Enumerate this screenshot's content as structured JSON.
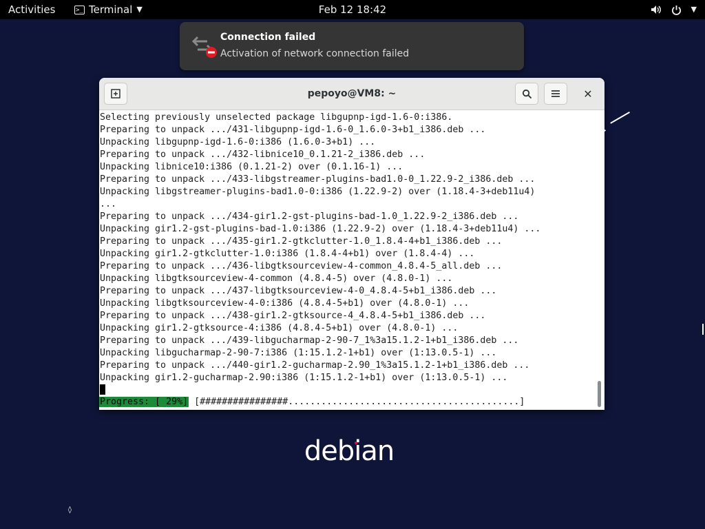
{
  "topbar": {
    "activities": "Activities",
    "app_name": "Terminal",
    "clock": "Feb 12  18:42"
  },
  "notification": {
    "title": "Connection failed",
    "body": "Activation of network connection failed"
  },
  "window": {
    "title": "pepoyo@VM8: ~"
  },
  "terminal": {
    "lines": [
      "Selecting previously unselected package libgupnp-igd-1.6-0:i386.",
      "Preparing to unpack .../431-libgupnp-igd-1.6-0_1.6.0-3+b1_i386.deb ...",
      "Unpacking libgupnp-igd-1.6-0:i386 (1.6.0-3+b1) ...",
      "Preparing to unpack .../432-libnice10_0.1.21-2_i386.deb ...",
      "Unpacking libnice10:i386 (0.1.21-2) over (0.1.16-1) ...",
      "Preparing to unpack .../433-libgstreamer-plugins-bad1.0-0_1.22.9-2_i386.deb ...",
      "Unpacking libgstreamer-plugins-bad1.0-0:i386 (1.22.9-2) over (1.18.4-3+deb11u4)",
      "...",
      "Preparing to unpack .../434-gir1.2-gst-plugins-bad-1.0_1.22.9-2_i386.deb ...",
      "Unpacking gir1.2-gst-plugins-bad-1.0:i386 (1.22.9-2) over (1.18.4-3+deb11u4) ...",
      "Preparing to unpack .../435-gir1.2-gtkclutter-1.0_1.8.4-4+b1_i386.deb ...",
      "Unpacking gir1.2-gtkclutter-1.0:i386 (1.8.4-4+b1) over (1.8.4-4) ...",
      "Preparing to unpack .../436-libgtksourceview-4-common_4.8.4-5_all.deb ...",
      "Unpacking libgtksourceview-4-common (4.8.4-5) over (4.8.0-1) ...",
      "Preparing to unpack .../437-libgtksourceview-4-0_4.8.4-5+b1_i386.deb ...",
      "Unpacking libgtksourceview-4-0:i386 (4.8.4-5+b1) over (4.8.0-1) ...",
      "Preparing to unpack .../438-gir1.2-gtksource-4_4.8.4-5+b1_i386.deb ...",
      "Unpacking gir1.2-gtksource-4:i386 (4.8.4-5+b1) over (4.8.0-1) ...",
      "Preparing to unpack .../439-libgucharmap-2-90-7_1%3a15.1.2-1+b1_i386.deb ...",
      "Unpacking libgucharmap-2-90-7:i386 (1:15.1.2-1+b1) over (1:13.0.5-1) ...",
      "Preparing to unpack .../440-gir1.2-gucharmap-2.90_1%3a15.1.2-1+b1_i386.deb ...",
      "Unpacking gir1.2-gucharmap-2.90:i386 (1:15.1.2-1+b1) over (1:13.0.5-1) ..."
    ],
    "progress_label": "Progress: [ 29%]",
    "progress_bar": "[################..........................................]",
    "progress_fraction": 0.29
  },
  "desktop": {
    "logo_text": "debian"
  },
  "colors": {
    "progress_badge": "#1d8a3a",
    "desktop_bg": "#0f1538",
    "notif_bg": "#353535"
  },
  "icons": [
    "terminal-app-icon",
    "chevron-down-icon",
    "volume-icon",
    "power-icon",
    "network-error-icon",
    "new-tab-icon",
    "search-icon",
    "hamburger-menu-icon",
    "close-icon"
  ]
}
